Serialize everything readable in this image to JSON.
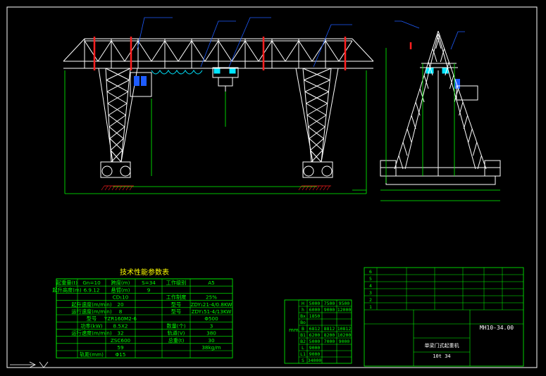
{
  "colors": {
    "background": "#000000",
    "frame": "#ffffff",
    "structure": "#ffffff",
    "dimension": "#00ff00",
    "leader": "#1e5cff",
    "table": "#00ff00",
    "title_yellow": "#ffff00",
    "red": "#ff2020",
    "cyan": "#00e5ff"
  },
  "spec_table": {
    "title": "技术性能参数表",
    "rows": [
      [
        "起重量(t)",
        "Gn=10",
        "跨度(m)",
        "S=34",
        "工作级别",
        "A5"
      ],
      [
        "起升高度(m)",
        "6.9.12",
        "悬臂(m)",
        "9",
        "",
        ""
      ],
      [
        "",
        "",
        "CD₁10",
        "",
        "工作制度",
        "25%"
      ],
      [
        "",
        "起升速度(m/min)",
        "20",
        "",
        "型号",
        "ZDY₁21-4/0.8KW"
      ],
      [
        "",
        "运行速度(m/min)",
        "8",
        "",
        "型号",
        "ZDY₁51-4/13KW"
      ],
      [
        "",
        "型号",
        "YZR160M2-6",
        "",
        "",
        "Φ500"
      ],
      [
        "",
        "功率(kW)",
        "8.5X2",
        "",
        "数量(个)",
        "3"
      ],
      [
        "",
        "运行速度(m/min)",
        "32",
        "",
        "轨道(V)",
        "380"
      ],
      [
        "",
        "",
        "ZSC600",
        "",
        "总重(t)",
        "30"
      ],
      [
        "",
        "",
        "59",
        "",
        "",
        "38kg/m"
      ],
      [
        "",
        "轨距(mm)",
        "Φ15",
        "",
        "",
        ""
      ]
    ]
  },
  "dim_table": {
    "unit": "mm",
    "rows": [
      [
        "H",
        "5000",
        "7500",
        "9500"
      ],
      [
        "h",
        "6000",
        "9000",
        "12000"
      ],
      [
        "Bx",
        "1850",
        "",
        ""
      ],
      [
        "Bo",
        "",
        "",
        ""
      ],
      [
        "B",
        "6812",
        "8812",
        "10812"
      ],
      [
        "B1",
        "6200",
        "8200",
        "10200"
      ],
      [
        "B2",
        "5000",
        "7000",
        "9000"
      ],
      [
        "L",
        "9000",
        "",
        ""
      ],
      [
        "L1",
        "9000",
        "",
        ""
      ],
      [
        "S",
        "34000",
        "",
        ""
      ]
    ]
  },
  "title_block": {
    "drawing_no": "MH10-34.00",
    "name": "单梁门式起重机",
    "spec": "10t  34",
    "parts_rows": [
      "6",
      "5",
      "4",
      "3",
      "2",
      "1"
    ]
  }
}
